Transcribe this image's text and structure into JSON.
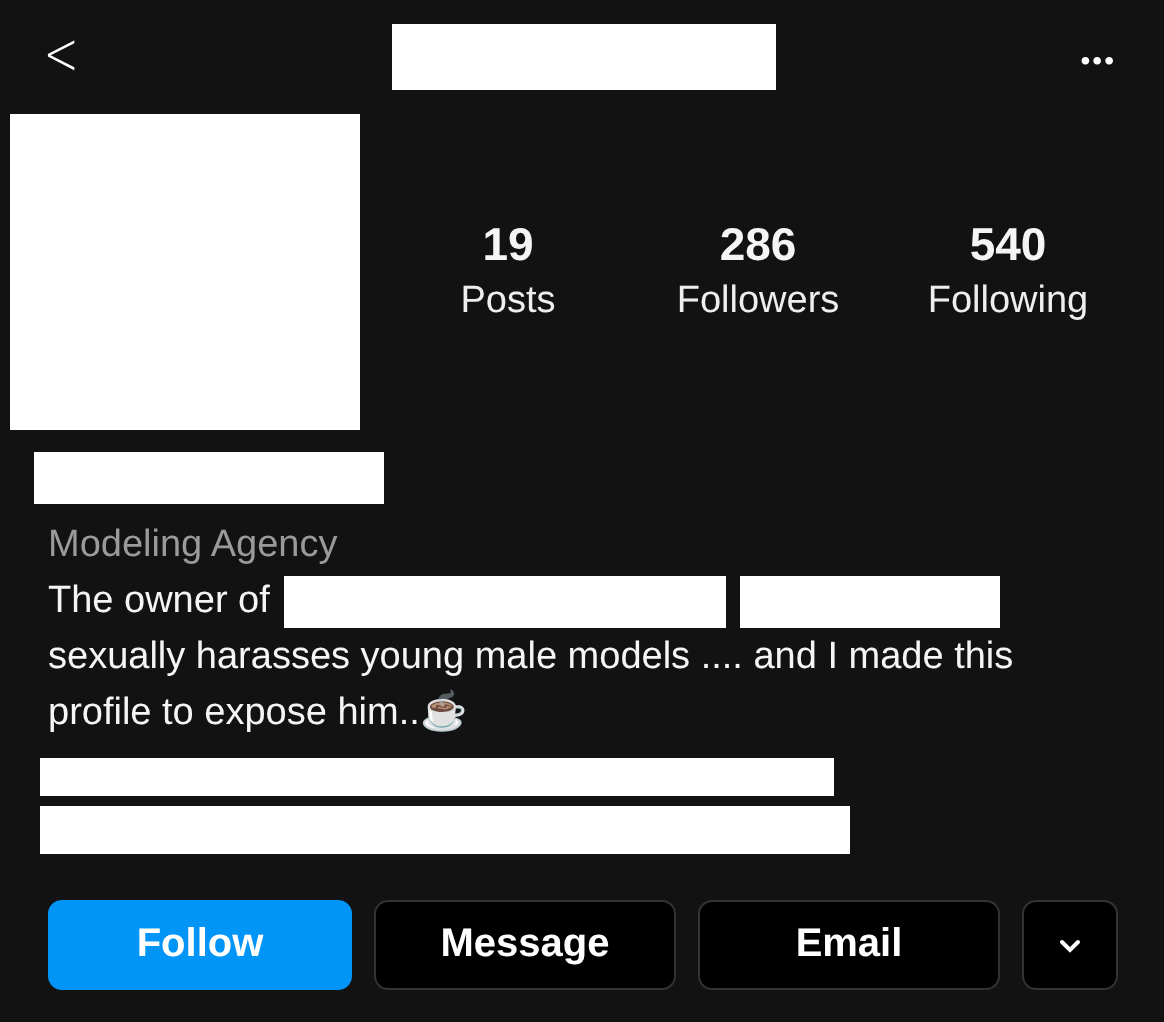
{
  "header": {
    "back": "<",
    "menu": "•••"
  },
  "stats": [
    {
      "value": "19",
      "label": "Posts"
    },
    {
      "value": "286",
      "label": "Followers"
    },
    {
      "value": "540",
      "label": "Following"
    }
  ],
  "category": "Modeling Agency",
  "bio": {
    "intro": "The owner of",
    "text": "sexually harasses young male models .... and I made this profile to expose him..☕"
  },
  "buttons": [
    {
      "kind": "primary",
      "label": "Follow"
    },
    {
      "kind": "secondary",
      "label": "Message"
    },
    {
      "kind": "secondary",
      "label": "Email"
    },
    {
      "kind": "dropdown"
    }
  ]
}
